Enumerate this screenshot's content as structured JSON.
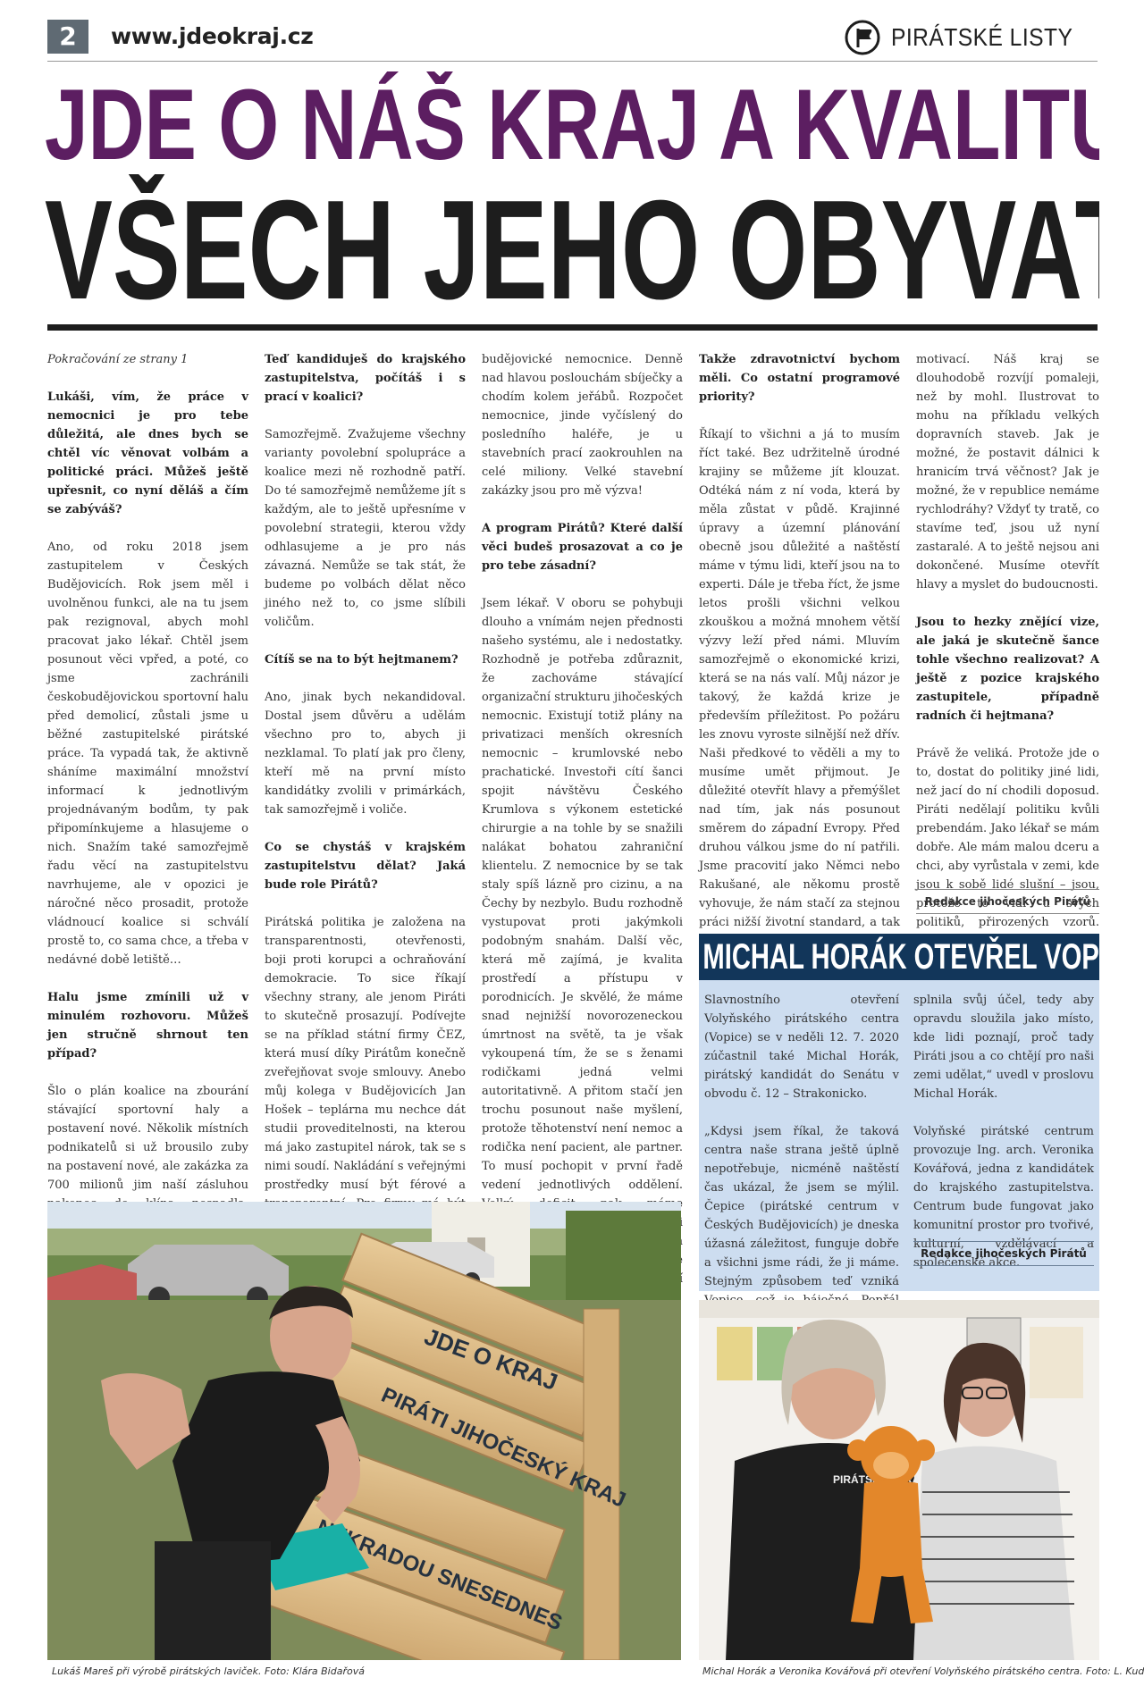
{
  "header": {
    "page_number": "2",
    "site": "www.jdeokraj.cz",
    "brand": "PIRÁTSKÉ LISTY",
    "logo_icon": "pirate-flag-icon"
  },
  "headline": {
    "line1": "JDE O NÁŠ KRAJ A KVALITU ŽIVOTA",
    "line2": "VŠECH JEHO OBYVATEL",
    "color1": "#5c1e61"
  },
  "article": {
    "col1": [
      {
        "type": "cont",
        "text": "Pokračování ze strany 1"
      },
      {
        "type": "q",
        "text": "Lukáši, vím, že práce v nemocnici je pro tebe důležitá, ale dnes bych se chtěl víc věnovat volbám a politické práci. Můžeš ještě upřesnit, co nyní děláš a čím se zabýváš?"
      },
      {
        "type": "p",
        "text": "Ano, od roku 2018 jsem zastupitelem v Českých Budějovicích. Rok jsem měl i uvolněnou funkci, ale na tu jsem pak rezignoval, abych mohl pracovat jako lékař. Chtěl jsem posunout věci vpřed, a poté, co jsme zachránili českobudějovickou sportovní halu před demolicí, zůstali jsme u běžné zastupitelské pirátské práce. Ta vypadá tak, že aktivně sháníme maximální množství informací k jednotlivým projednávaným bodům, ty pak připomínkujeme a hlasujeme o nich. Snažím také samozřejmě řadu věcí na zastupitelstvu navrhujeme, ale v opozici je náročné něco prosadit, protože vládnoucí koalice si schválí prostě to, co sama chce, a třeba v nedávné době letiště…"
      },
      {
        "type": "q",
        "text": "Halu jsme zmínili už v minulém rozhovoru. Můžeš jen stručně shrnout ten případ?"
      },
      {
        "type": "p",
        "text": "Šlo o plán koalice na zbourání stávající sportovní haly a postavení nové. Několik místních podnikatelů si už brousilo zuby na postavení nové, ale zakázka za 700 milionů jim naší zásluhou nakonec do klína nespadla. Někdo může říct, že Budějovice mohly mít krásnou novou stavbu a proslavit se, ale všichni to známe. Když se staví podle cinknutého projektu s cinknutým rozpočtem, tak tomu výsledek odpovídá. Chci, aby město dostalo za své peníze kvalitu. Tohle byl předražený šunt."
      }
    ],
    "col2": [
      {
        "type": "q",
        "text": "Teď kandiduješ do krajského zastupitelstva, počítáš i s prací v koalici?"
      },
      {
        "type": "p",
        "text": "Samozřejmě. Zvažujeme všechny varianty povolební spolupráce a koalice mezi ně rozhodně patří. Do té samozřejmě nemůžeme jít s každým, ale to ještě upřesníme v povolební strategii, kterou vždy odhlasujeme a je pro nás závazná. Nemůže se tak stát, že budeme po volbách dělat něco jiného než to, co jsme slíbili voličům."
      },
      {
        "type": "q",
        "text": "Cítíš se na to být hejtmanem?"
      },
      {
        "type": "p",
        "text": "Ano, jinak bych nekandidoval. Dostal jsem důvěru a udělám všechno pro to, abych ji nezklamal. To platí jak pro členy, kteří mě na první místo kandidátky zvolili v primárkách, tak samozřejmě i voliče."
      },
      {
        "type": "q",
        "text": "Co se chystáš v krajském zastupitelstvu dělat? Jaká bude role Pirátů?"
      },
      {
        "type": "p",
        "text": "Pirátská politika je založena na transparentnosti, otevřenosti, boji proti korupci a ochraňování demokracie. To sice říkají všechny strany, ale jenom Piráti to skutečně prosazují. Podívejte se na příklad státní firmy ČEZ, která musí díky Pirátům konečně zveřejňovat svoje smlouvy. Anebo můj kolega v Budějovicích Jan Hošek – teplárna mu nechce dát studii proveditelnosti, na kterou má jako zastupitel nárok, tak se s nimi soudí. Nakládání s veřejnými prostředky musí být férové a transparentní. Pro firmy má být veřejná zakázka luxus, protože mají jistotu, že jim město nebo kraj zaplatí. Takovou politiku budeme prosazovat. Určitě je třeba si posvítit na velké stavební zakázky, asi největší investice je teď do"
      }
    ],
    "col3": [
      {
        "type": "p",
        "text": "budějovické nemocnice. Denně nad hlavou poslouchám sbíječky a chodím kolem jeřábů. Rozpočet nemocnice, jinde vyčíslený do posledního haléře, je u stavebních prací zaokrouhlen na celé miliony. Velké stavební zakázky jsou pro mě výzva!"
      },
      {
        "type": "q",
        "text": "A program Pirátů? Které další věci budeš prosazovat a co je pro tebe zásadní?"
      },
      {
        "type": "p",
        "text": "Jsem lékař. V oboru se pohybuji dlouho a vnímám nejen přednosti našeho systému, ale i nedostatky. Rozhodně je potřeba zdůraznit, že zachováme stávající organizační strukturu jihočeských nemocnic. Existují totiž plány na privatizaci menších okresních nemocnic – krumlovské nebo prachatické. Investoři cítí šanci spojit návštěvu Českého Krumlova s výkonem estetické chirurgie a na tohle by se snažili nalákat bohatou zahraniční klientelu. Z nemocnice by se tak staly spíš lázně pro cizinu, a na Čechy by nezbylo. Budu rozhodně vystupovat proti jakýmkoli podobným snahám. Další věc, která mě zajímá, je kvalita prostředí a přístupu v porodnicích. Je skvělé, že máme snad nejnižší novorozeneckou úmrtnost na světě, ta je však vykoupená tím, že se s ženami rodičkami jedná velmi autoritativně. A přitom stačí jen trochu posunout naše myšlení, protože těhotenství není nemoc a rodička není pacient, ale partner. To musí pochopit v první řadě vedení jednotlivých oddělení. Velký deficit pak máme samozřejmě v kyberbezpečnosti nemocnic a obecně v projektech na zlepšení komunikace a péče prostřednictvím sdílení informací a know-how mezi zdravotníky."
      }
    ],
    "col4": [
      {
        "type": "q",
        "text": "Takže zdravotnictví bychom měli. Co ostatní programové priority?"
      },
      {
        "type": "p",
        "text": "Říkají to všichni a já to musím říct také. Bez udržitelně úrodné krajiny se můžeme jít klouzat. Odtéká nám z ní voda, která by měla zůstat v půdě. Krajinné úpravy a územní plánování obecně jsou důležité a naštěstí máme v týmu lidi, kteří jsou na to experti. Dále je třeba říct, že jsme letos prošli všichni velkou zkouškou a možná mnohem větší výzvy leží před námi. Mluvím samozřejmě o ekonomické krizi, která se na nás valí. Můj názor je takový, že každá krize je především příležitost. Po požáru les znovu vyroste silnější než dřív. Naši předkové to věděli a my to musíme umět přijmout. Je důležité otevřít hlavy a přemýšlet nad tím, jak nás posunout směrem do západní Evropy. Před druhou válkou jsme do ní patřili. Jsme pracovití jako Němci nebo Rakušané, ale někomu prostě vyhovuje, že nám stačí za stejnou práci nižší životní standard, a tak toho využívá. Je třeba tlačit na plošné zvyšování mezd. Průmysl 4.0 a digitalizace nám v tom pomohou, když se to vezme za správný konec a se správnou"
      }
    ],
    "col5": [
      {
        "type": "p",
        "text": "motivací. Náš kraj se dlouhodobě rozvíjí pomaleji, než by mohl. Ilustrovat to mohu na příkladu velkých dopravních staveb. Jak je možné, že postavit dálnici k hranicím trvá věčnost? Jak je možné, že v republice nemáme rychlodráhy? Vždyť ty tratě, co stavíme teď, jsou už nyní zastaralé. A to ještě nejsou ani dokončené. Musíme otevřít hlavy a myslet do budoucnosti."
      },
      {
        "type": "q",
        "text": "Jsou to hezky znějící vize, ale jaká je skutečně šance tohle všechno realizovat? A ještě z pozice krajského zastupitele, případně radních či hejtmana?"
      },
      {
        "type": "p",
        "text": "Právě že veliká. Protože jde o to, dostat do politiky jiné lidi, než jací do ní chodili doposud. Piráti nedělají politiku kvůli prebendám. Jako lékař se mám dobře. Ale mám malou dceru a chci, aby vyrůstala v zemi, kde jsou k sobě lidé slušní – jsou, protože to vidí u svých politiků, přirozených vzorů. Nám jde o každý hlas, na každém hlasu záleží. Máme teď šanci změnit budoucnost našeho kraje."
      }
    ],
    "signature": "Redakce jihočeských Pirátů"
  },
  "sidebar": {
    "title": "MICHAL HORÁK OTEVŘEL VOPICI",
    "title_bg": "#12365a",
    "bg": "#cdddf0",
    "col1": [
      "Slavnostního otevření Volyňského pirátského centra (Vopice) se v neděli 12. 7. 2020 zúčastnil také Michal Horák, pirátský kandidát do Senátu v obvodu č. 12 – Strakonicko.",
      "„Kdysi jsem říkal, že taková centra naše strana ještě úplně nepotřebuje, nicméně naštěstí čas ukázal, že jsem se mýlil. Čepice (pirátské centrum v Českých Budějovicích) je dneska úžasná záležitost, funguje dobře a všichni jsme rádi, že ji máme. Stejným způsobem teď vzniká Vopice, což je báječné. Popřál bych jí, aby"
    ],
    "col2": [
      "splnila svůj účel, tedy aby opravdu sloužila jako místo, kde lidi poznají, proč tady Piráti jsou a co chtějí pro naši zemi udělat,“ uvedl v proslovu Michal Horák.",
      "Volyňské pirátské centrum provozuje Ing. arch. Veronika Kovářová, jedna z kandidátek do krajského zastupitelstva. Centrum bude fungovat jako komunitní prostor pro tvořivé, kulturní, vzdělávací a společenské akce."
    ],
    "signature": "Redakce jihočeských Pirátů"
  },
  "photos": {
    "photo1": {
      "caption": "Lukáš Mareš při výrobě pirátských laviček. Foto: Klára Bidařová",
      "bench_text1": "JDE O KRAJ",
      "bench_text2": "PIRÁTI JIHOČESKÝ KRAJ",
      "bench_text3": "NEKRADOU SNESEDNES"
    },
    "photo2": {
      "caption": "Michal Horák a Veronika Kovářová při otevření Volyňského pirátského centra. Foto: L. Kudláček",
      "shirt_text": "PIRÁTSKÁ STRANA"
    }
  }
}
